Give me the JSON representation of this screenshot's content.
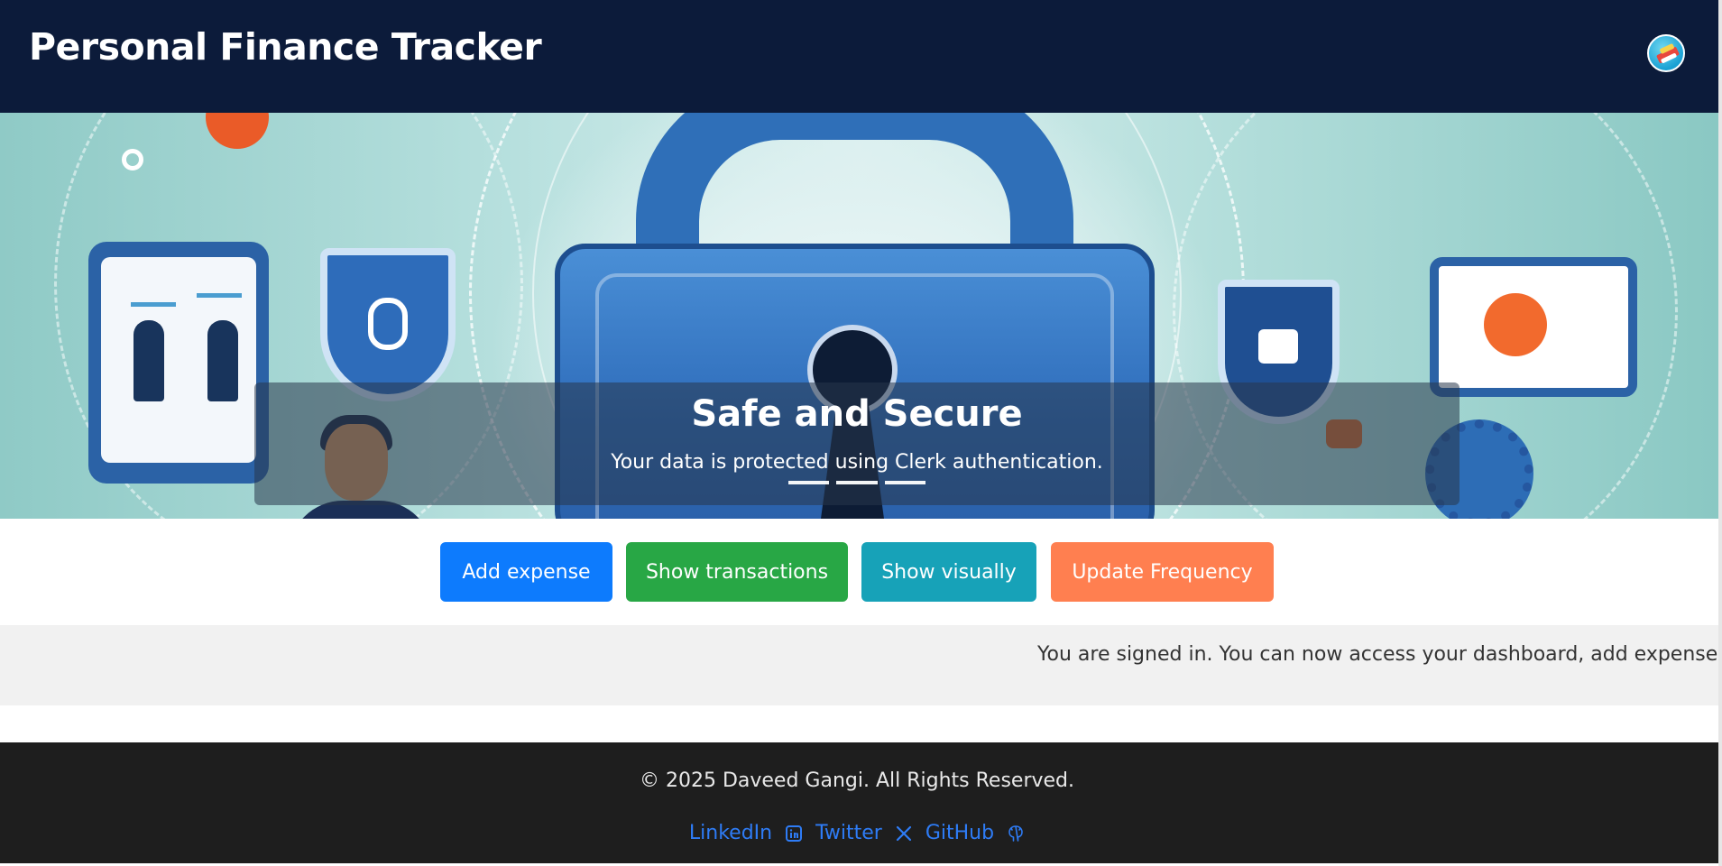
{
  "header": {
    "title": "Personal Finance Tracker"
  },
  "carousel": {
    "slide_title": "Safe and Secure",
    "slide_text": "Your data is protected using Clerk authentication.",
    "indicator_count": 3,
    "active_index": 1
  },
  "actions": {
    "add_expense": "Add expense",
    "show_transactions": "Show transactions",
    "show_visually": "Show visually",
    "update_frequency": "Update Frequency"
  },
  "status": {
    "message": "You are signed in. You can now access your dashboard, add expenses, v"
  },
  "footer": {
    "copyright": "© 2025 Daveed Gangi. All Rights Reserved.",
    "links": {
      "linkedin": "LinkedIn",
      "twitter": "Twitter",
      "github": "GitHub"
    }
  },
  "colors": {
    "header_bg": "#0c1b3a",
    "btn_blue": "#0d7bfd",
    "btn_green": "#28a745",
    "btn_teal": "#17a2b8",
    "btn_orange": "#ff7f50",
    "footer_bg": "#1e1e1e",
    "link": "#2e7cf6"
  },
  "icons": {
    "linkedin": "linkedin-icon",
    "twitter": "x-icon",
    "github": "github-icon"
  }
}
